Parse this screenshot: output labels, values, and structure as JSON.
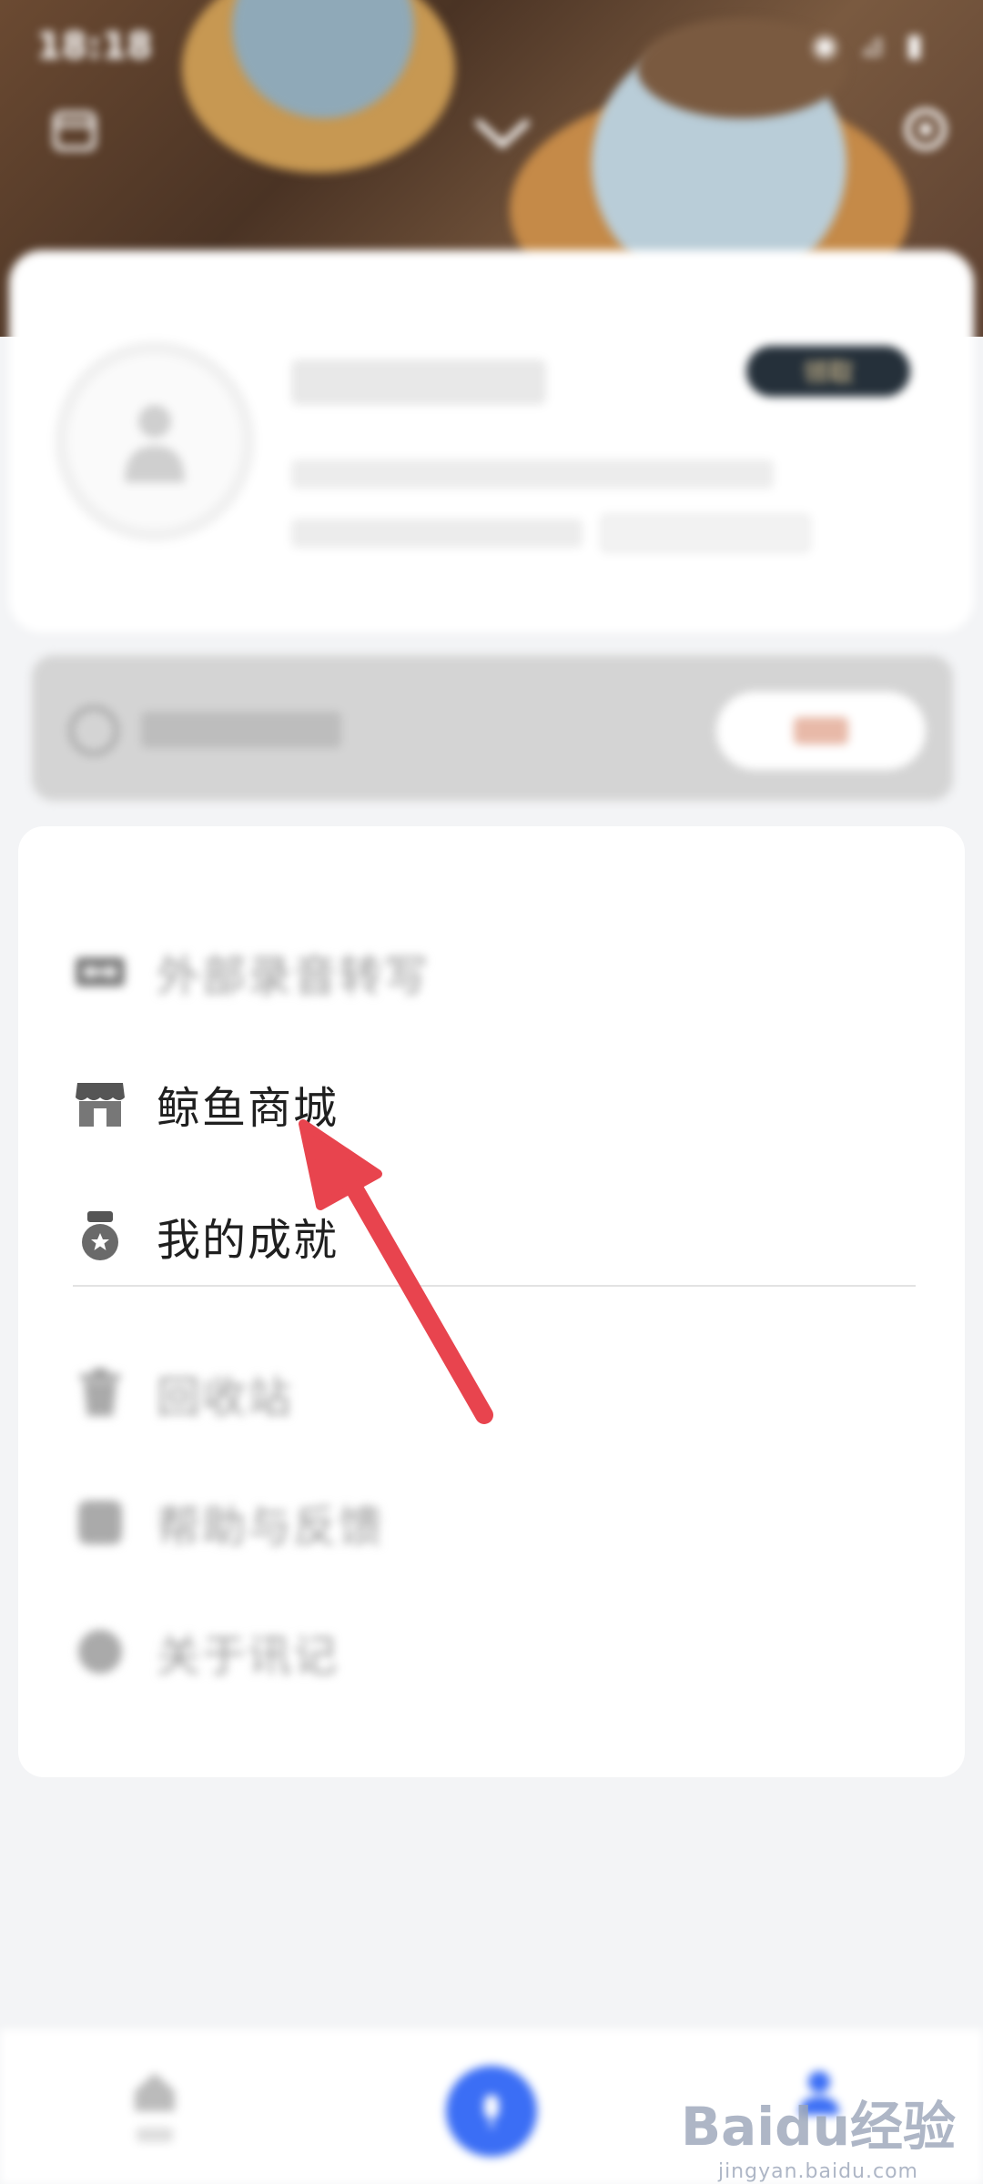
{
  "status_bar": {
    "time": "18:18",
    "right_indicators": "◉ ⊿ ▮"
  },
  "profile": {
    "vip_label": "领取",
    "avatar_icon": "user-silhouette-icon"
  },
  "banner": {
    "icon": "refresh-icon"
  },
  "menu": {
    "items": [
      {
        "label": "外部录音转写",
        "icon": "cassette-icon",
        "dim": true
      },
      {
        "label": "鲸鱼商城",
        "icon": "store-icon",
        "dim": false
      },
      {
        "label": "我的成就",
        "icon": "medal-icon",
        "dim": false
      }
    ],
    "secondary_items": [
      {
        "label": "回收站",
        "icon": "trash-icon"
      },
      {
        "label": "帮助与反馈",
        "icon": "help-icon"
      },
      {
        "label": "关于讯记",
        "icon": "info-icon"
      }
    ]
  },
  "watermark": {
    "brand": "Baidu经验",
    "url": "jingyan.baidu.com"
  },
  "colors": {
    "accent": "#3b6ef5",
    "arrow": "#e8444e",
    "vip_bg": "#25303a"
  }
}
